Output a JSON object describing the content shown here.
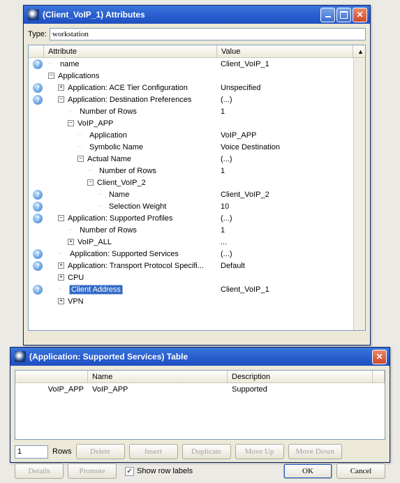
{
  "win1": {
    "title": "(Client_VoIP_1) Attributes",
    "type_label": "Type:",
    "type_value": "workstation",
    "headers": {
      "attr": "Attribute",
      "value": "Value"
    },
    "rows": [
      {
        "icon": "q",
        "indent": 0,
        "toggle": "line",
        "label": "name",
        "value": "Client_VoIP_1"
      },
      {
        "icon": "",
        "indent": 0,
        "toggle": "minus",
        "label": "Applications",
        "value": ""
      },
      {
        "icon": "q",
        "indent": 1,
        "toggle": "plus",
        "label": "Application: ACE Tier Configuration",
        "value": "Unspecified"
      },
      {
        "icon": "q",
        "indent": 1,
        "toggle": "minus",
        "label": "Application: Destination Preferences",
        "value": "(...)"
      },
      {
        "icon": "",
        "indent": 2,
        "toggle": "line",
        "label": "Number of Rows",
        "value": "1"
      },
      {
        "icon": "",
        "indent": 2,
        "toggle": "minus",
        "label": "VoIP_APP",
        "value": ""
      },
      {
        "icon": "",
        "indent": 3,
        "toggle": "line",
        "label": "Application",
        "value": "VoIP_APP"
      },
      {
        "icon": "",
        "indent": 3,
        "toggle": "line",
        "label": "Symbolic Name",
        "value": "Voice Destination"
      },
      {
        "icon": "",
        "indent": 3,
        "toggle": "minus",
        "label": "Actual Name",
        "value": "(...)"
      },
      {
        "icon": "",
        "indent": 4,
        "toggle": "line",
        "label": "Number of Rows",
        "value": "1"
      },
      {
        "icon": "",
        "indent": 4,
        "toggle": "minus",
        "label": "Client_VoIP_2",
        "value": ""
      },
      {
        "icon": "q",
        "indent": 5,
        "toggle": "line",
        "label": "Name",
        "value": "Client_VoIP_2"
      },
      {
        "icon": "q",
        "indent": 5,
        "toggle": "line",
        "label": "Selection Weight",
        "value": "10"
      },
      {
        "icon": "q",
        "indent": 1,
        "toggle": "minus",
        "label": "Application: Supported Profiles",
        "value": "(...)"
      },
      {
        "icon": "",
        "indent": 2,
        "toggle": "line",
        "label": "Number of Rows",
        "value": "1"
      },
      {
        "icon": "",
        "indent": 2,
        "toggle": "plus",
        "label": "VoIP_ALL",
        "value": "..."
      },
      {
        "icon": "q",
        "indent": 1,
        "toggle": "line",
        "label": "Application: Supported Services",
        "value": "(...)"
      },
      {
        "icon": "q",
        "indent": 1,
        "toggle": "plus",
        "label": "Application: Transport Protocol Specifi...",
        "value": "Default"
      },
      {
        "icon": "",
        "indent": 1,
        "toggle": "plus",
        "label": "CPU",
        "value": ""
      },
      {
        "icon": "q",
        "indent": 1,
        "toggle": "line",
        "label": "Client Address",
        "value": "Client_VoIP_1",
        "selected": true
      },
      {
        "icon": "",
        "indent": 1,
        "toggle": "plus",
        "label": "VPN",
        "value": ""
      }
    ]
  },
  "win2": {
    "title": "(Application: Supported Services) Table",
    "headers": {
      "name": "Name",
      "desc": "Description"
    },
    "row": {
      "key": "VoIP_APP",
      "name": "VoIP_APP",
      "desc": "Supported"
    },
    "rows_value": "1",
    "rows_label": "Rows",
    "buttons": {
      "delete": "Delete",
      "insert": "Insert",
      "duplicate": "Duplicate",
      "moveup": "Move Up",
      "movedown": "Move Down",
      "details": "Details",
      "promote": "Promote",
      "ok": "OK",
      "cancel": "Cancel"
    },
    "show_row_labels": "Show row labels"
  }
}
